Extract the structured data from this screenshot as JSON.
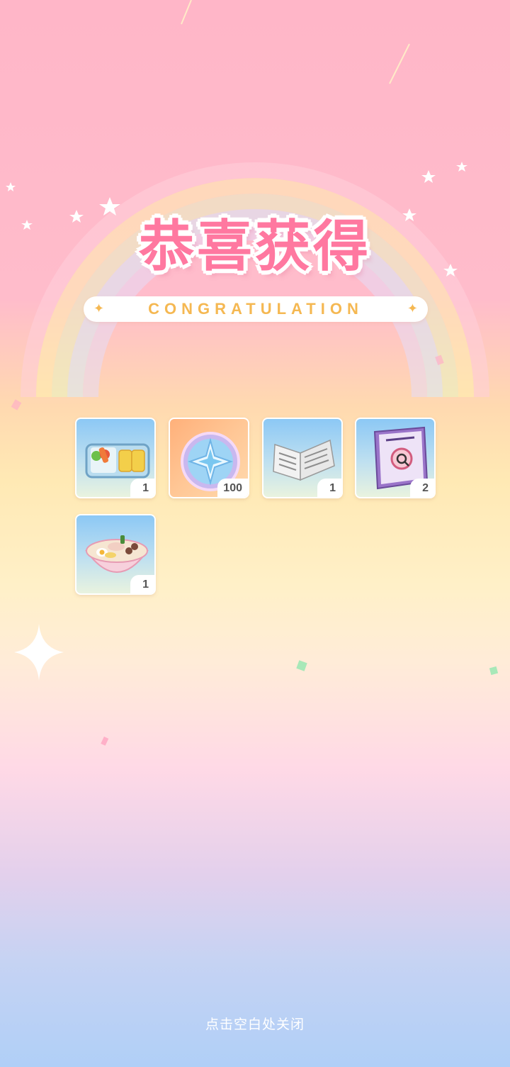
{
  "title": "恭喜获得",
  "subtitle": "CONGRATULATION",
  "rewards": [
    {
      "icon": "bento-box-icon",
      "quantity": "1"
    },
    {
      "icon": "star-crystal-coin-icon",
      "quantity": "100"
    },
    {
      "icon": "newspaper-icon",
      "quantity": "1"
    },
    {
      "icon": "detective-notebook-icon",
      "quantity": "2"
    },
    {
      "icon": "ramen-bowl-icon",
      "quantity": "1"
    }
  ],
  "close_hint": "点击空白处关闭",
  "colors": {
    "title": "#ff78a0",
    "subtitle": "#f5b852",
    "slot_bg": "#8cc8f5",
    "coin_slot_bg": "#ffb07a"
  }
}
